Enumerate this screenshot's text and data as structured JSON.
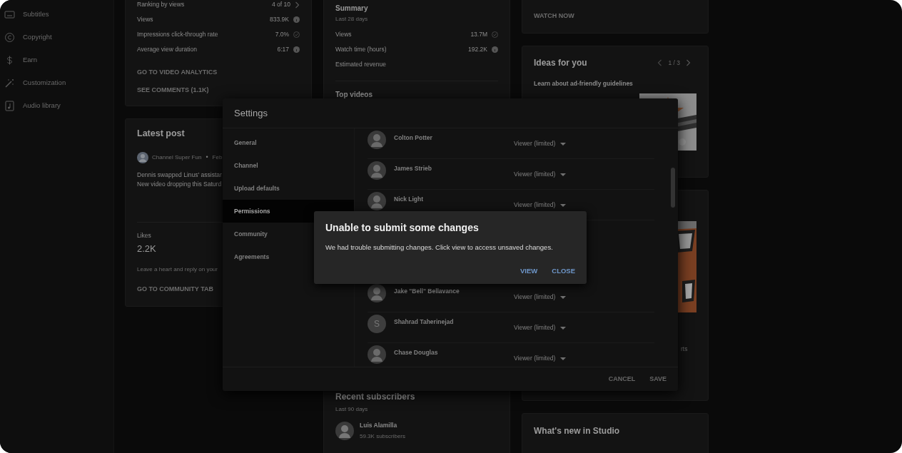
{
  "sidebar": {
    "items": [
      {
        "label": "Subtitles"
      },
      {
        "label": "Copyright"
      },
      {
        "label": "Earn"
      },
      {
        "label": "Customization"
      },
      {
        "label": "Audio library"
      }
    ]
  },
  "video_card": {
    "stats": [
      {
        "label": "Ranking by views",
        "value": "4 of 10"
      },
      {
        "label": "Views",
        "value": "833.9K"
      },
      {
        "label": "Impressions click-through rate",
        "value": "7.0%"
      },
      {
        "label": "Average view duration",
        "value": "6:17"
      }
    ],
    "links": [
      "GO TO VIDEO ANALYTICS",
      "SEE COMMENTS (1.1K)"
    ]
  },
  "latest_post": {
    "title": "Latest post",
    "author": "Channel Super Fun",
    "separator": "•",
    "date": "Feb",
    "lines": [
      "Dennis swapped Linus' assistar",
      "New video dropping this Saturd"
    ],
    "likes_label": "Likes",
    "likes": "2.2K",
    "hint": "Leave a heart and reply on your",
    "link": "GO TO COMMUNITY TAB"
  },
  "summary": {
    "title": "Summary",
    "period": "Last 28 days",
    "stats": [
      {
        "label": "Views",
        "value": "13.7M"
      },
      {
        "label": "Watch time (hours)",
        "value": "192.2K"
      },
      {
        "label": "Estimated revenue"
      }
    ],
    "top_videos": "Top videos"
  },
  "recent_subscribers": {
    "title": "Recent subscribers",
    "period": "Last 90 days",
    "items": [
      {
        "name": "Luis Alamilla",
        "subscribers": "59.3K subscribers"
      }
    ]
  },
  "creators_card": {
    "link": "WATCH NOW"
  },
  "ideas": {
    "title": "Ideas for you",
    "page": "1 / 3",
    "headline": "Learn about ad-friendly guidelines"
  },
  "promo_card": {
    "text": "rts"
  },
  "whats_new": {
    "title": "What's new in Studio"
  },
  "settings": {
    "title": "Settings",
    "nav": [
      {
        "label": "General",
        "selected": false
      },
      {
        "label": "Channel",
        "selected": false
      },
      {
        "label": "Upload defaults",
        "selected": false
      },
      {
        "label": "Permissions",
        "selected": true
      },
      {
        "label": "Community",
        "selected": false
      },
      {
        "label": "Agreements",
        "selected": false
      }
    ],
    "members_above": [
      {
        "name": "Colton Potter",
        "role": "Viewer (limited)"
      },
      {
        "name": "James Strieb",
        "role": "Viewer (limited)"
      },
      {
        "name": "Nick Light",
        "role": "Viewer (limited)"
      }
    ],
    "members_below": [
      {
        "name": "Jake \"Bell\" Bellavance",
        "role": "Viewer (limited)"
      },
      {
        "name": "Shahrad Taherinejad",
        "role": "Viewer (limited)",
        "kind": "initial",
        "initial": "S"
      },
      {
        "name": "Chase Douglas",
        "role": "Viewer (limited)"
      }
    ],
    "buttons": [
      "CANCEL",
      "SAVE"
    ]
  },
  "alert": {
    "title": "Unable to submit some changes",
    "message": "We had trouble submitting changes. Click view to access unsaved changes.",
    "buttons": [
      "VIEW",
      "CLOSE"
    ]
  }
}
